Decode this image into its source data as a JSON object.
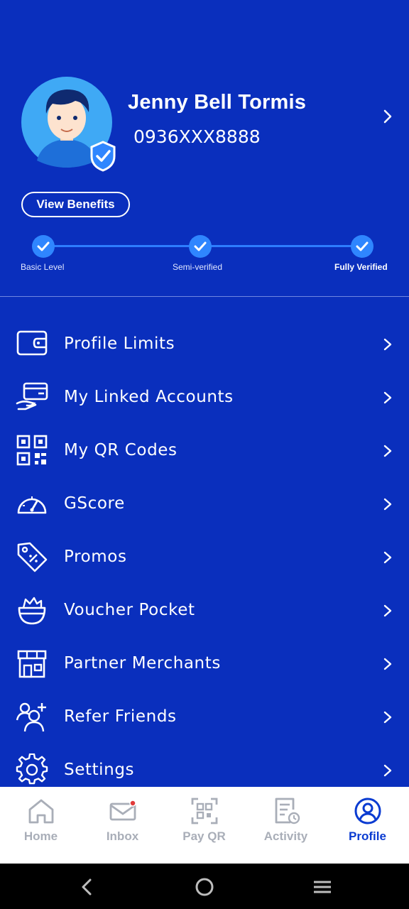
{
  "profile": {
    "name": "Jenny Bell Tormis",
    "phone": "0936XXX8888",
    "benefits_label": "View Benefits",
    "verification_steps": [
      {
        "label": "Basic Level"
      },
      {
        "label": "Semi-verified"
      },
      {
        "label": "Fully Verified"
      }
    ]
  },
  "menu": [
    {
      "label": "Profile Limits",
      "icon": "wallet-icon"
    },
    {
      "label": "My Linked Accounts",
      "icon": "linked-card-icon"
    },
    {
      "label": "My QR Codes",
      "icon": "qr-code-icon"
    },
    {
      "label": "GScore",
      "icon": "gauge-icon"
    },
    {
      "label": "Promos",
      "icon": "tag-icon"
    },
    {
      "label": "Voucher Pocket",
      "icon": "basket-icon"
    },
    {
      "label": "Partner Merchants",
      "icon": "store-icon"
    },
    {
      "label": "Refer Friends",
      "icon": "add-friends-icon"
    },
    {
      "label": "Settings",
      "icon": "gear-icon"
    }
  ],
  "bottom_nav": [
    {
      "label": "Home",
      "icon": "home-icon"
    },
    {
      "label": "Inbox",
      "icon": "inbox-icon"
    },
    {
      "label": "Pay QR",
      "icon": "scan-qr-icon"
    },
    {
      "label": "Activity",
      "icon": "activity-icon"
    },
    {
      "label": "Profile",
      "icon": "profile-icon",
      "active": true
    }
  ],
  "colors": {
    "background": "#0a2fbd",
    "accent": "#2f86ff",
    "nav_active": "#0a3bd1",
    "nav_inactive": "#a9aeb8"
  }
}
